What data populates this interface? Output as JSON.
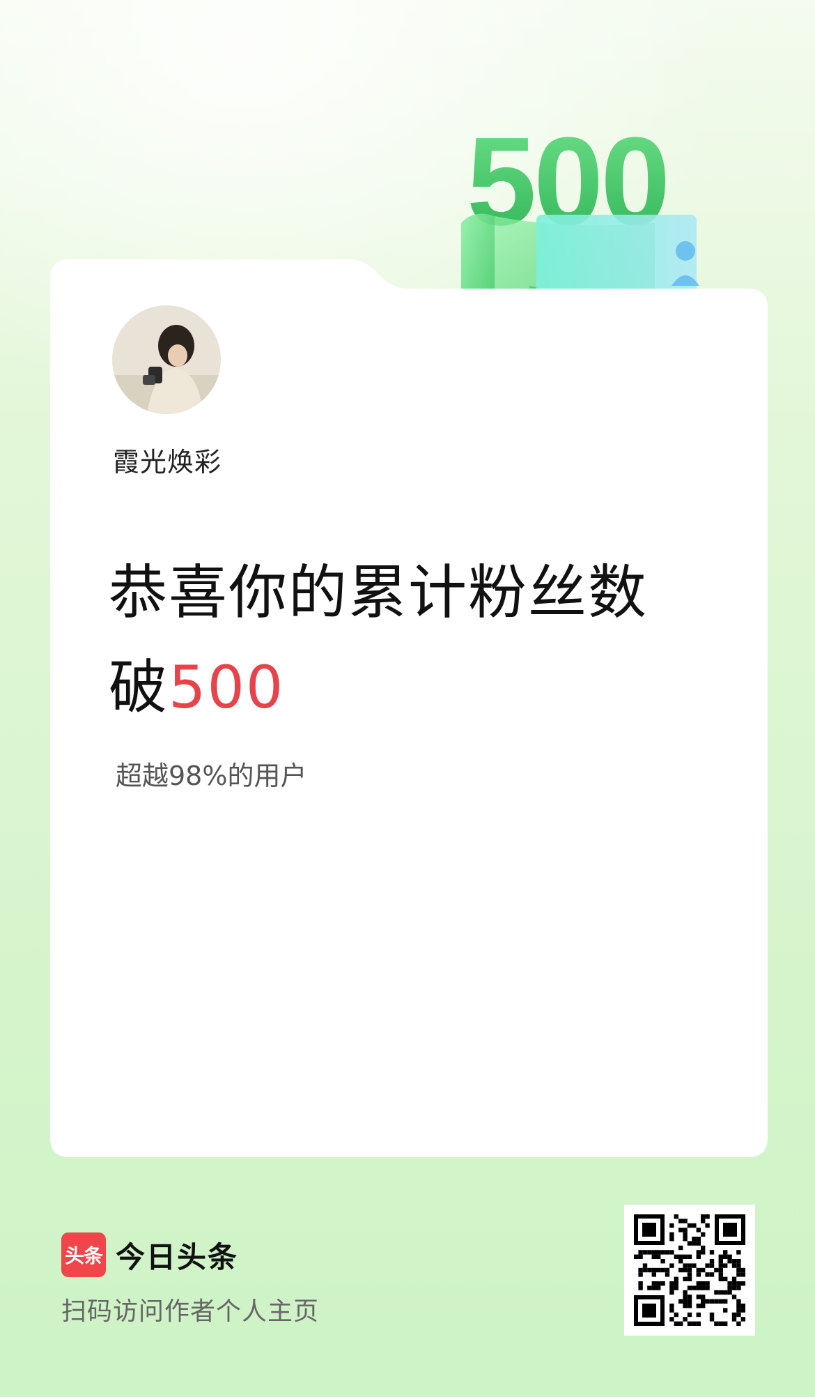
{
  "badge": {
    "number": "500"
  },
  "user": {
    "name": "霞光焕彩"
  },
  "headline": {
    "line1": "恭喜你的累计粉丝数",
    "line2_prefix": "破",
    "line2_number": "500"
  },
  "subtext": "超越98%的用户",
  "footer": {
    "brand_logo": "头条",
    "brand_name": "今日头条",
    "scan_text": "扫码访问作者个人主页"
  },
  "colors": {
    "accent": "#e8424a",
    "brand": "#f0454a",
    "badge_green": "#4cc86a"
  }
}
